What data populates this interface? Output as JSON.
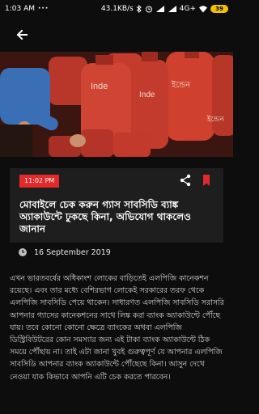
{
  "status": {
    "time": "1:03 AM",
    "network_speed": "43.1KB/s",
    "network_type": "4G+",
    "battery": "39"
  },
  "article": {
    "time_badge": "11:02 PM",
    "headline": "মোবাইলে চেক করুন গ্যাস সাবসিডি ব্যাঙ্ক অ্যাকাউন্টে ঢুকছে কিনা, অভিযোগ থাকলেও জানান",
    "date": "16 September 2019",
    "body": "এখন ভারতবর্ষের অধিকাংশ লোকের বাড়িতেই এলপিজি কানেকশন রয়েছে। এবং তার মধ্যে বেশিরভাগ লোকেই সরকারের তরফ থেকে এলপিজি সাবসিডি পেয়ে থাকেন। সাধারণত এলপিজি সাবসিডি সরাসরি আপনার গ্যাসের কানেকশনের সাথে লিঙ্ক করা ব্যাংক অ্যাকাউন্টে পৌঁছে যায়। তবে কোনো কোনো ক্ষেত্রে ব্যাংকের অথবা এলপিজি ডিস্ট্রিবিউটরের কোন সমস্যার জন্য এই টাকা ব্যাংক অ্যাকাউন্টে ঠিক সময়ে পৌঁছায় না। তাই এটা জানা খুবই গুরুত্বপূর্ণ যে আপনার এলপিজি সাবসিডি আপনার ব্যাংক অ্যাকাউন্টে পৌঁছেছে কিনা। আসুন দেখে নেওয়া যাক কিভাবে আপনি এটি চেক করতে পারবেন।"
  },
  "hero": {
    "cylinder_labels": [
      "Inde",
      "Inde",
      "ইন্ডেন",
      "ইন্ডেন"
    ]
  },
  "colors": {
    "accent": "#e22a2a",
    "background": "#0d0d0d",
    "card": "#1e1e1e"
  }
}
